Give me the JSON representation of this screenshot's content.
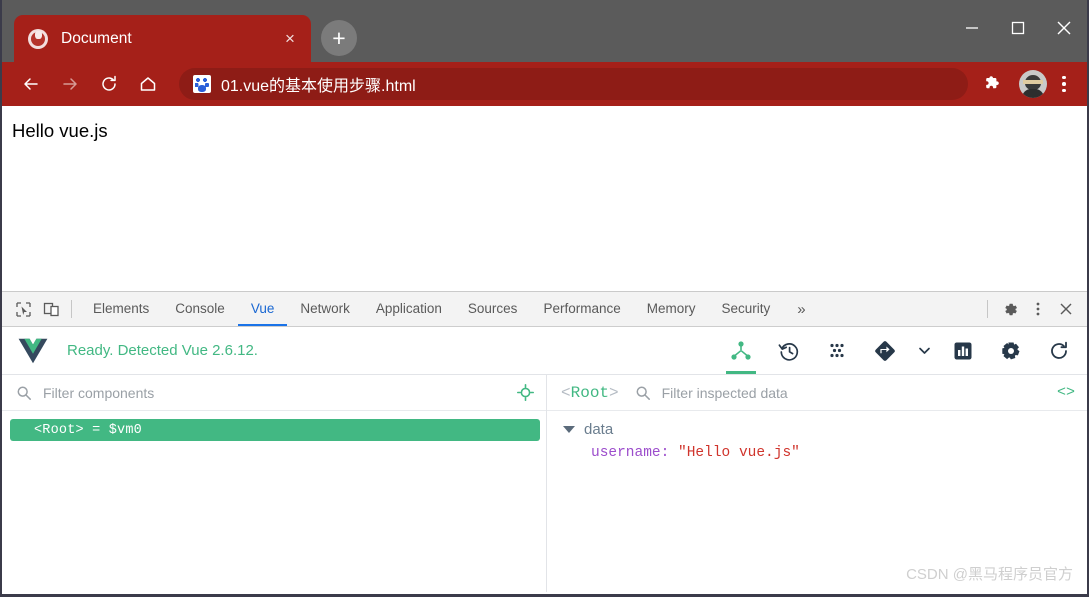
{
  "browser": {
    "tab": {
      "title": "Document",
      "favicon": "globe-icon",
      "close_label": "×"
    },
    "new_tab_label": "+",
    "window_controls": {
      "minimize": "minimize-icon",
      "maximize": "maximize-icon",
      "close": "close-icon"
    },
    "nav": {
      "back": "back-arrow-icon",
      "forward": "forward-arrow-icon",
      "reload": "reload-icon",
      "home": "home-icon",
      "extensions": "puzzle-icon",
      "profile": "incognito-avatar",
      "menu": "kebab-menu-icon"
    },
    "url": {
      "text": "01.vue的基本使用步骤.html",
      "favicon": "baidu-icon"
    },
    "colors": {
      "titlebar": "#5b5b5b",
      "toolbar": "#a52019",
      "urlbar": "#8e1c16"
    }
  },
  "page": {
    "text": "Hello vue.js"
  },
  "devtools": {
    "left_icons": {
      "inspect": "inspect-element-icon",
      "device": "device-toolbar-icon"
    },
    "tabs": [
      {
        "label": "Elements",
        "active": false
      },
      {
        "label": "Console",
        "active": false
      },
      {
        "label": "Vue",
        "active": true
      },
      {
        "label": "Network",
        "active": false
      },
      {
        "label": "Application",
        "active": false
      },
      {
        "label": "Sources",
        "active": false
      },
      {
        "label": "Performance",
        "active": false
      },
      {
        "label": "Memory",
        "active": false
      },
      {
        "label": "Security",
        "active": false
      }
    ],
    "more_label": "»",
    "right_icons": {
      "settings": "gear-icon",
      "menu": "kebab-menu-icon",
      "close": "close-icon"
    },
    "accent": "#1a73e8"
  },
  "vue_panel": {
    "logo": "vue-logo-icon",
    "status": "Ready. Detected Vue 2.6.12.",
    "status_color": "#42b883",
    "tools": [
      {
        "name": "components-tree-icon",
        "active": true
      },
      {
        "name": "timeline-history-icon",
        "active": false
      },
      {
        "name": "vuex-dots-icon",
        "active": false
      },
      {
        "name": "routing-diamond-icon",
        "active": false
      },
      {
        "name": "chevron-down-icon",
        "active": false
      },
      {
        "name": "performance-bars-icon",
        "active": false
      },
      {
        "name": "settings-gear-icon",
        "active": false
      },
      {
        "name": "refresh-icon",
        "active": false
      }
    ],
    "components_filter": {
      "placeholder": "Filter components",
      "value": "",
      "search_icon": "search-icon",
      "target_icon": "select-component-target-icon"
    },
    "tree": [
      {
        "open": "<",
        "name": "Root",
        "close": ">",
        "assign": " = $vm0",
        "selected": true,
        "full": "<Root> = $vm0"
      }
    ],
    "inspector": {
      "root_open": "<",
      "root_name": "Root",
      "root_close": ">",
      "filter_placeholder": "Filter inspected data",
      "filter_value": "",
      "code_icon_label": "<>",
      "groups": [
        {
          "name": "data",
          "expanded": true,
          "props": [
            {
              "key": "username:",
              "value": "\"Hello vue.js\""
            }
          ]
        }
      ]
    }
  },
  "watermark": {
    "text": "CSDN @黑马程序员官方"
  }
}
